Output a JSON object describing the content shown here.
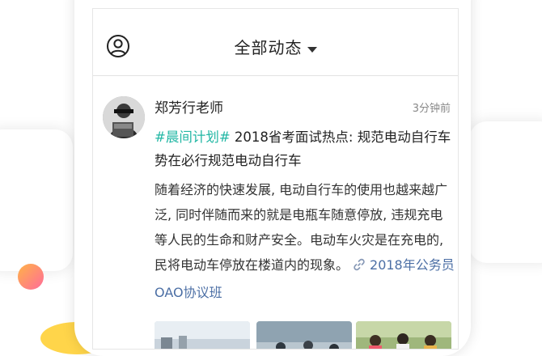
{
  "header": {
    "title": "全部动态"
  },
  "post": {
    "author": "郑芳行老师",
    "time": "3分钟前",
    "hashtag": "#晨间计划#",
    "headline": "2018省考面试热点: 规范电动自行车势在必行规范电动自行车",
    "body": "随着经济的快速发展, 电动自行车的使用也越来越广泛, 同时伴随而来的就是电瓶车随意停放, 违规充电等人民的生命和财产安全。电动车火灾是在充电的, 民将电动车停放在楼道内的现象。",
    "link_label": "2018年公务员OAO协议班"
  },
  "colors": {
    "hashtag": "#22b7a4",
    "link": "#4c6fa5"
  },
  "icons": {
    "profile": "user-circle-icon",
    "dropdown": "caret-down-icon",
    "link": "link-icon"
  }
}
